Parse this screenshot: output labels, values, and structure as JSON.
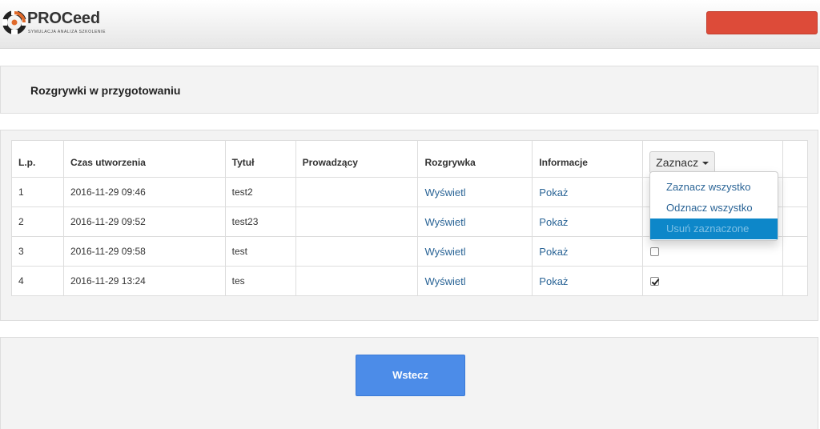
{
  "header": {
    "logo_text": "PROCeed",
    "logo_tagline": "SYMULACJA  ANALIZA  SZKOLENIE"
  },
  "page": {
    "title": "Rozgrywki w przygotowaniu"
  },
  "table": {
    "columns": [
      "L.p.",
      "Czas utworzenia",
      "Tytuł",
      "Prowadzący",
      "Rozgrywka",
      "Informacje"
    ],
    "select_button_label": "Zaznacz",
    "rows": [
      {
        "lp": "1",
        "created": "2016-11-29 09:46",
        "title": "test2",
        "host": "",
        "game_link": "Wyświetl",
        "info_link": "Pokaż",
        "checked": false
      },
      {
        "lp": "2",
        "created": "2016-11-29 09:52",
        "title": "test23",
        "host": "",
        "game_link": "Wyświetl",
        "info_link": "Pokaż",
        "checked": false
      },
      {
        "lp": "3",
        "created": "2016-11-29 09:58",
        "title": "test",
        "host": "",
        "game_link": "Wyświetl",
        "info_link": "Pokaż",
        "checked": false
      },
      {
        "lp": "4",
        "created": "2016-11-29 13:24",
        "title": "tes",
        "host": "",
        "game_link": "Wyświetl",
        "info_link": "Pokaż",
        "checked": true
      }
    ]
  },
  "select_menu": {
    "items": [
      "Zaznacz wszystko",
      "Odznacz wszystko",
      "Usuń zaznaczone"
    ],
    "highlighted_index": 2
  },
  "footer": {
    "back_label": "Wstecz"
  },
  "colors": {
    "danger": "#dd4b39",
    "primary": "#4c8ce8",
    "link": "#2a6496",
    "menu_highlight": "#0d87c9"
  }
}
